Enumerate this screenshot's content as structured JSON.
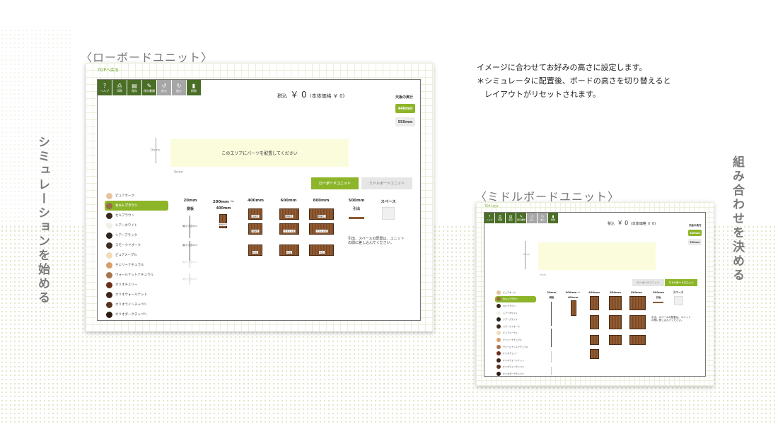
{
  "headings": {
    "low": "〈ローボードユニット〉",
    "middle": "〈ミドルボードユニット〉"
  },
  "side_text": {
    "left": "シミュレーションを始める",
    "right": "組み合わせを決める"
  },
  "note": {
    "line1": "イメージに合わせてお好みの高さに設定します。",
    "line2": "＊シミュレータに配置後、ボードの高さを切り替えると",
    "line3": "レイアウトがリセットされます。"
  },
  "sim": {
    "top_link": "TOPへ戻る",
    "toolbar": [
      {
        "icon": "?",
        "label": "ヘルプ",
        "name": "help-icon",
        "disabled": false
      },
      {
        "icon": "⎙",
        "label": "印刷",
        "name": "print-icon",
        "disabled": false
      },
      {
        "icon": "▤",
        "label": "保存",
        "name": "save-icon",
        "disabled": false
      },
      {
        "icon": "✎",
        "label": "保存書類",
        "name": "saved-docs-icon",
        "disabled": false
      },
      {
        "icon": "↺",
        "label": "戻る",
        "name": "undo-icon",
        "disabled": true
      },
      {
        "icon": "↻",
        "label": "進む",
        "name": "redo-icon",
        "disabled": true
      },
      {
        "icon": "▮",
        "label": "削除",
        "name": "trash-icon",
        "disabled": false
      }
    ],
    "price_prefix": "税込",
    "price_big": "￥ 0",
    "price_note": "(本体価格 ￥ 0)",
    "depth_title": "天板の奥行",
    "depth_options": [
      "440mm",
      "550mm"
    ],
    "height_zero": "0mm",
    "width_zero": "0mm",
    "drop_text": "このエリアにパーツを配置してください",
    "unit_tabs": [
      "ローボードユニット",
      "ミドルボードユニット"
    ],
    "colors": [
      {
        "name": "ピュアオーク",
        "hex": "#e6c49a"
      },
      {
        "name": "セルトブラウン",
        "hex": "#9a6a45"
      },
      {
        "name": "セルブラウン",
        "hex": "#3b261a"
      },
      {
        "name": "シアーホワイト",
        "hex": "#f1efe8"
      },
      {
        "name": "シアーブラック",
        "hex": "#2a2521"
      },
      {
        "name": "スモークドオーク",
        "hex": "#3a2d22"
      },
      {
        "name": "ピュアメープル",
        "hex": "#f0dcb7"
      },
      {
        "name": "チェリーナチュラル",
        "hex": "#d99d6a"
      },
      {
        "name": "ウォールナットナチュラル",
        "hex": "#a7744d"
      },
      {
        "name": "オリオチェリー",
        "hex": "#6b2e1a"
      },
      {
        "name": "オリオウォールナット",
        "hex": "#3b2418"
      },
      {
        "name": "オリオラインチャペリ",
        "hex": "#5a3320"
      },
      {
        "name": "オリオダークチャペリ",
        "hex": "#2c1a12"
      }
    ],
    "columns": [
      "20mm",
      "200mm ～",
      "400mm",
      "600mm",
      "800mm",
      "500mm",
      "スペース"
    ],
    "col_sub": {
      "side": "側板",
      "w400": "400mm",
      "drawer": "引出"
    },
    "side_labels": [
      "最小寸法mm",
      "最小寸法mm",
      "最小寸法mm",
      "最小寸法mm"
    ],
    "box_label_400": "800mm",
    "part_labels": {
      "open_400": "全開き",
      "open_600": "両開き",
      "open_800": "両開き",
      "slide_400": "片開き",
      "slide_600": "スライド扉",
      "slide_800": "スライド扉",
      "drawer": "引出"
    },
    "space_note": "引出、スペースの配置は、ユニットの間に差し込んでください。"
  }
}
